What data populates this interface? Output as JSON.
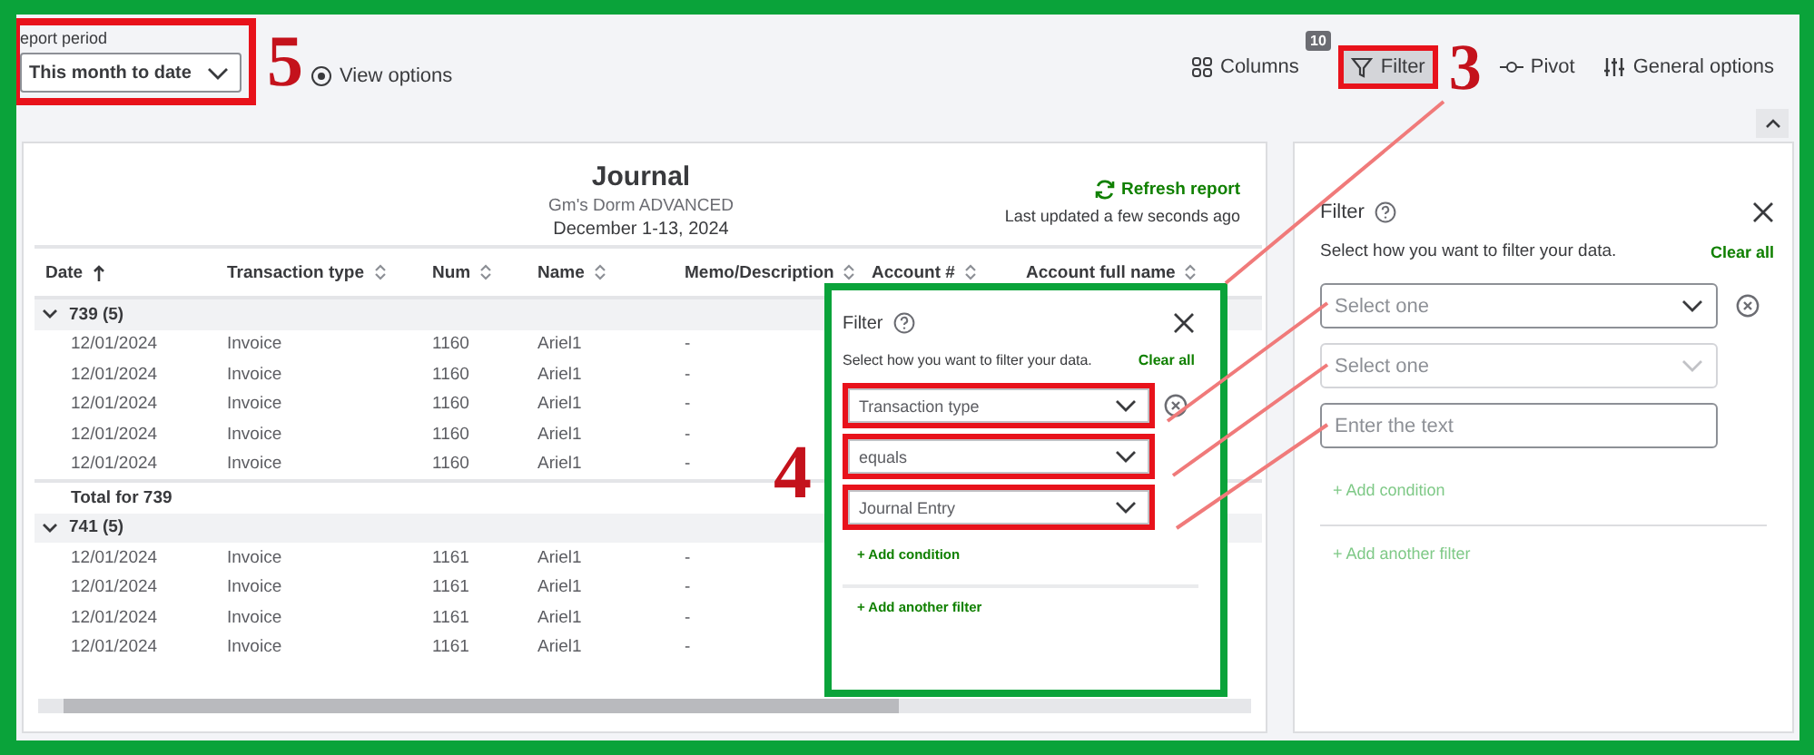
{
  "report_period": {
    "label": "eport period",
    "value": "This month to date"
  },
  "toolbar": {
    "view_options": "View options",
    "actions": [
      {
        "kind": "columns",
        "label": "Columns",
        "badge": "10",
        "selected": false
      },
      {
        "kind": "filter",
        "label": "Filter",
        "selected": true
      },
      {
        "kind": "pivot",
        "label": "Pivot",
        "selected": false
      },
      {
        "kind": "general",
        "label": "General options",
        "selected": false
      }
    ]
  },
  "report": {
    "title": "Journal",
    "company": "Gm's Dorm ADVANCED",
    "date_range": "December 1-13, 2024",
    "refresh": "Refresh report",
    "last_updated": "Last updated a few seconds ago",
    "columns": [
      {
        "label": "Date",
        "sorted": true
      },
      {
        "label": "Transaction type",
        "sorted": false
      },
      {
        "label": "Num",
        "sorted": false
      },
      {
        "label": "Name",
        "sorted": false
      },
      {
        "label": "Memo/Description",
        "sorted": false
      },
      {
        "label": "Account #",
        "sorted": false
      },
      {
        "label": "Account full name",
        "sorted": false
      }
    ],
    "groups": [
      {
        "label": "739 (5)",
        "expanded": true,
        "rows": [
          [
            "12/01/2024",
            "Invoice",
            "1160",
            "Ariel1",
            "-"
          ],
          [
            "12/01/2024",
            "Invoice",
            "1160",
            "Ariel1",
            "-"
          ],
          [
            "12/01/2024",
            "Invoice",
            "1160",
            "Ariel1",
            "-"
          ],
          [
            "12/01/2024",
            "Invoice",
            "1160",
            "Ariel1",
            "-"
          ],
          [
            "12/01/2024",
            "Invoice",
            "1160",
            "Ariel1",
            "-"
          ]
        ],
        "total": "Total for 739"
      },
      {
        "label": "741 (5)",
        "expanded": true,
        "rows": [
          [
            "12/01/2024",
            "Invoice",
            "1161",
            "Ariel1",
            "-"
          ],
          [
            "12/01/2024",
            "Invoice",
            "1161",
            "Ariel1",
            "-"
          ],
          [
            "12/01/2024",
            "Invoice",
            "1161",
            "Ariel1",
            "-"
          ],
          [
            "12/01/2024",
            "Invoice",
            "1161",
            "Ariel1",
            "-"
          ]
        ]
      }
    ]
  },
  "filter_popup": {
    "title": "Filter",
    "hint": "Select how you want to filter your data.",
    "clear_all": "Clear all",
    "fields": [
      {
        "value": "Transaction type",
        "removable": true
      },
      {
        "value": "equals",
        "removable": false
      },
      {
        "value": "Journal Entry",
        "removable": false
      }
    ],
    "add_condition": {
      "label": "+ Add condition",
      "disabled": false
    },
    "add_another_filter": {
      "label": "+ Add another filter",
      "disabled": false
    }
  },
  "filter_panel": {
    "title": "Filter",
    "hint": "Select how you want to filter your data.",
    "clear_all": "Clear all",
    "fields": [
      {
        "kind": "select",
        "placeholder": "Select one",
        "disabled": false,
        "removable": true
      },
      {
        "kind": "select",
        "placeholder": "Select one",
        "disabled": true,
        "removable": false
      },
      {
        "kind": "text",
        "placeholder": "Enter the text",
        "disabled": false,
        "removable": false
      }
    ],
    "add_condition": {
      "label": "+ Add condition",
      "disabled": true
    },
    "add_another_filter": {
      "label": "+ Add another filter",
      "disabled": true
    }
  },
  "callouts": {
    "report_period": "5",
    "filter_button": "3",
    "filter_popup": "4"
  }
}
